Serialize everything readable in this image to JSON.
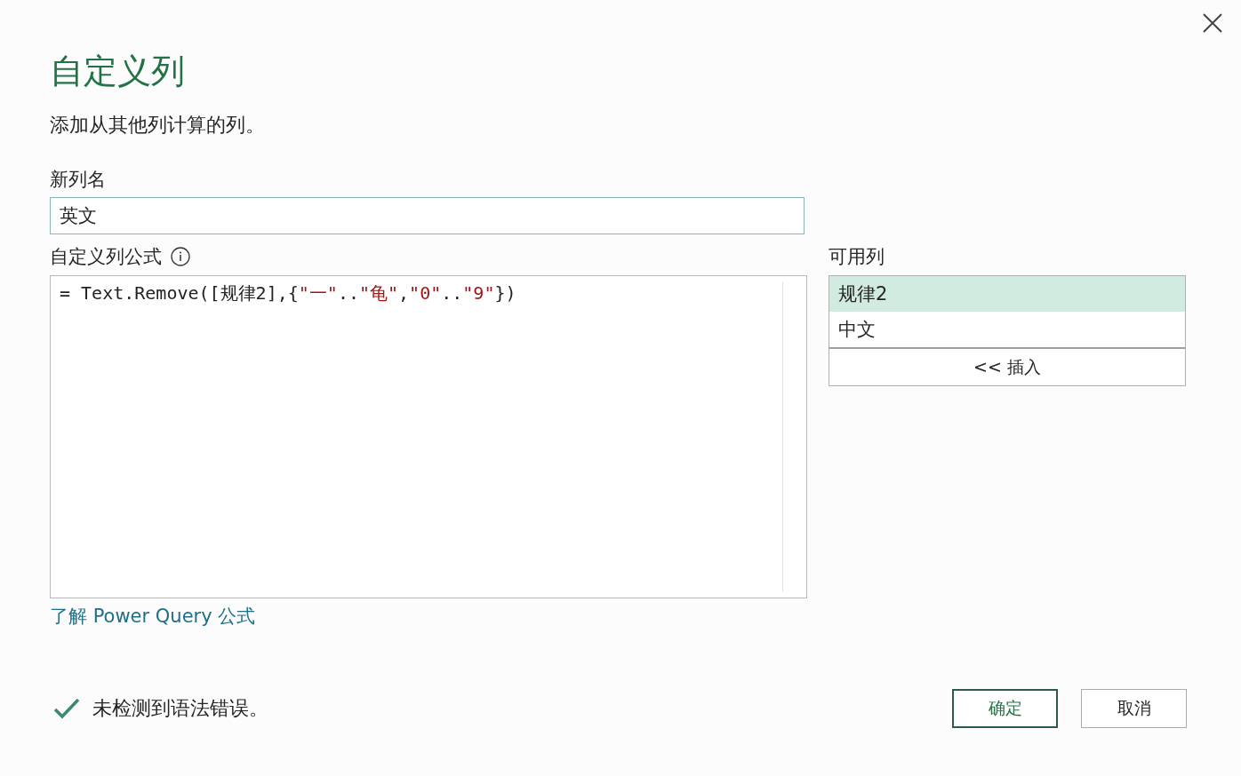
{
  "dialog": {
    "title": "自定义列",
    "subtitle": "添加从其他列计算的列。"
  },
  "new_column_name": {
    "label": "新列名",
    "value": "英文"
  },
  "formula": {
    "label": "自定义列公式",
    "tokens": [
      {
        "kind": "plain",
        "text": "= Text.Remove([规律2],{"
      },
      {
        "kind": "string",
        "text": "\"一\""
      },
      {
        "kind": "plain",
        "text": ".."
      },
      {
        "kind": "string",
        "text": "\"龟\""
      },
      {
        "kind": "plain",
        "text": ","
      },
      {
        "kind": "string",
        "text": "\"0\""
      },
      {
        "kind": "plain",
        "text": ".."
      },
      {
        "kind": "string",
        "text": "\"9\""
      },
      {
        "kind": "plain",
        "text": "})"
      }
    ]
  },
  "learn_link": "了解 Power Query 公式",
  "available_columns": {
    "label": "可用列",
    "items": [
      {
        "name": "规律2",
        "selected": true
      },
      {
        "name": "中文",
        "selected": false
      }
    ],
    "insert_button": "<< 插入"
  },
  "status": {
    "kind": "ok",
    "text": "未检测到语法错误。"
  },
  "buttons": [
    {
      "label": "确定",
      "primary": true
    },
    {
      "label": "取消",
      "primary": false
    }
  ]
}
